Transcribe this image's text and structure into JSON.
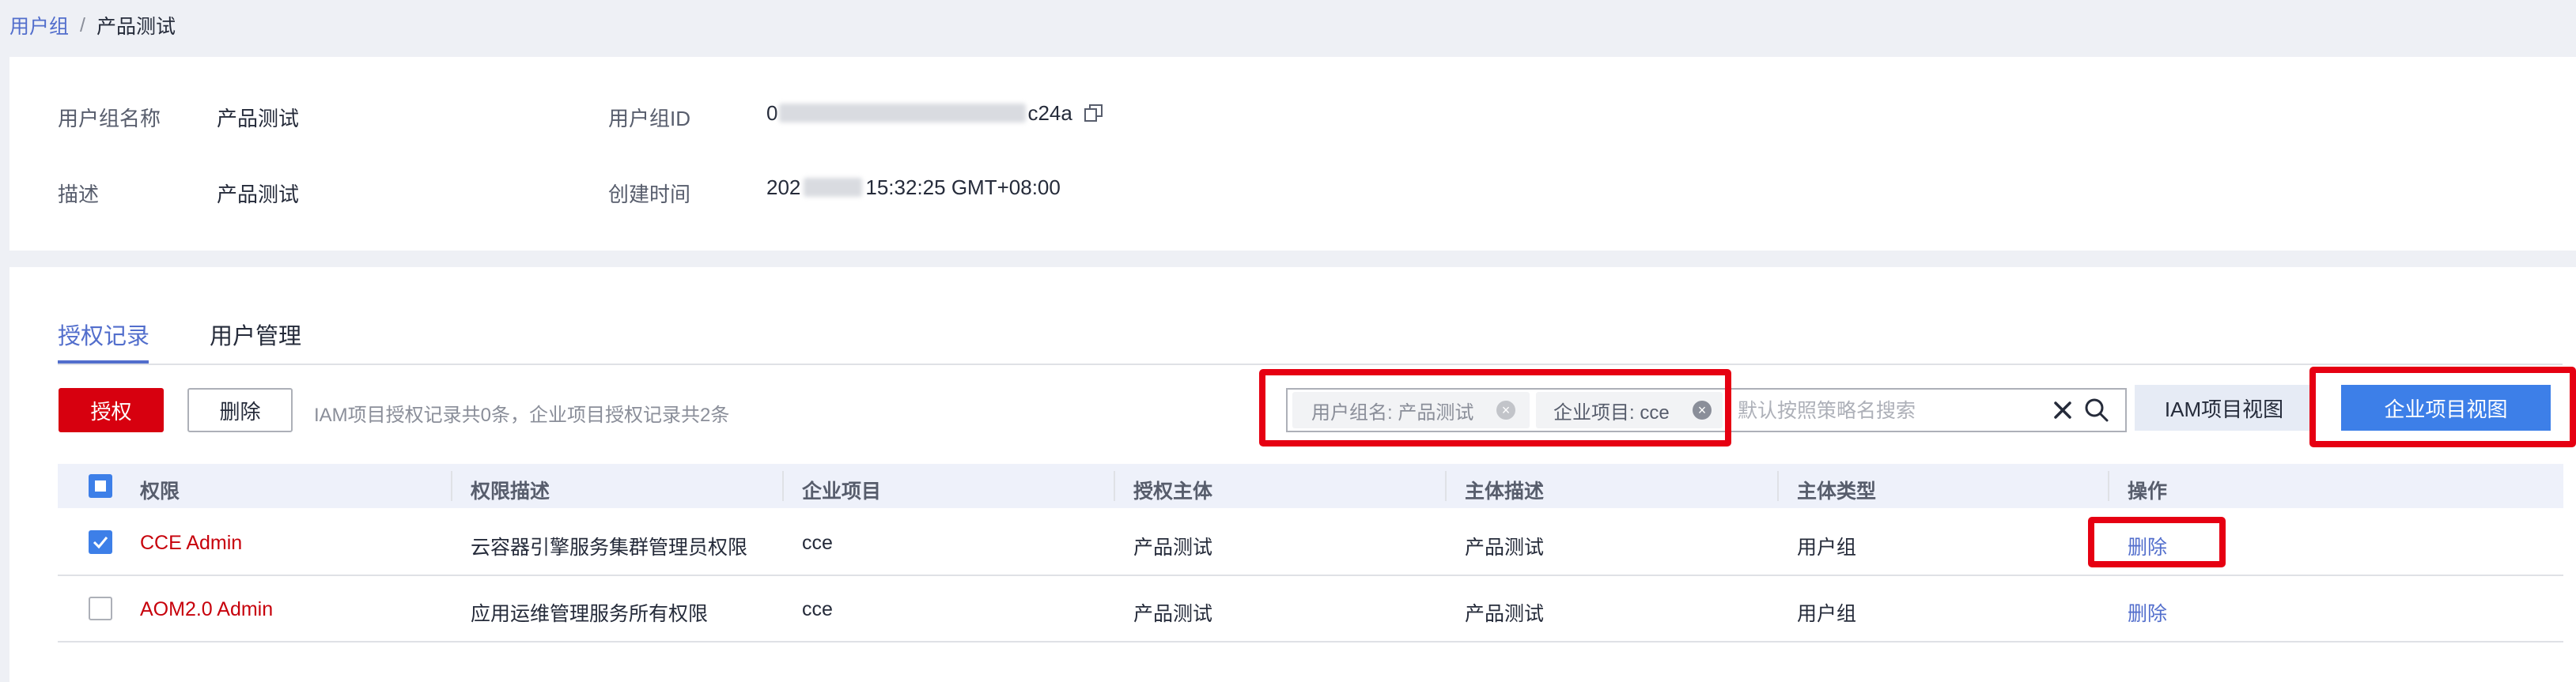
{
  "breadcrumb": {
    "parent": "用户组",
    "separator": "/",
    "current": "产品测试"
  },
  "info": {
    "name_label": "用户组名称",
    "name_value": "产品测试",
    "id_label": "用户组ID",
    "id_prefix": "0",
    "id_suffix": "c24a",
    "desc_label": "描述",
    "desc_value": "产品测试",
    "created_label": "创建时间",
    "created_prefix": "202",
    "created_suffix": "15:32:25 GMT+08:00"
  },
  "tabs": [
    {
      "label": "授权记录"
    },
    {
      "label": "用户管理"
    }
  ],
  "toolbar": {
    "grant_label": "授权",
    "delete_label": "删除",
    "summary": "IAM项目授权记录共0条，企业项目授权记录共2条"
  },
  "filter": {
    "chips": [
      {
        "label": "用户组名: 产品测试"
      },
      {
        "label": "企业项目: cce"
      }
    ],
    "placeholder": "默认按照策略名搜索"
  },
  "views": {
    "iam_label": "IAM项目视图",
    "enterprise_label": "企业项目视图"
  },
  "table": {
    "headers": [
      "权限",
      "权限描述",
      "企业项目",
      "授权主体",
      "主体描述",
      "主体类型",
      "操作"
    ],
    "rows": [
      {
        "permission": "CCE Admin",
        "description": "云容器引擎服务集群管理员权限",
        "project": "cce",
        "principal": "产品测试",
        "principal_desc": "产品测试",
        "principal_type": "用户组",
        "action": "删除",
        "checked": true
      },
      {
        "permission": "AOM2.0 Admin",
        "description": "应用运维管理服务所有权限",
        "project": "cce",
        "principal": "产品测试",
        "principal_desc": "产品测试",
        "principal_type": "用户组",
        "action": "删除",
        "checked": false
      }
    ]
  },
  "colors": {
    "brand_red": "#d7000f",
    "link_blue": "#526ecc",
    "primary_blue": "#3d7fe8",
    "highlight_red": "#e60012"
  },
  "icons": [
    "copy-icon",
    "chip-remove-icon",
    "clear-icon",
    "search-icon",
    "checkbox-icon"
  ]
}
